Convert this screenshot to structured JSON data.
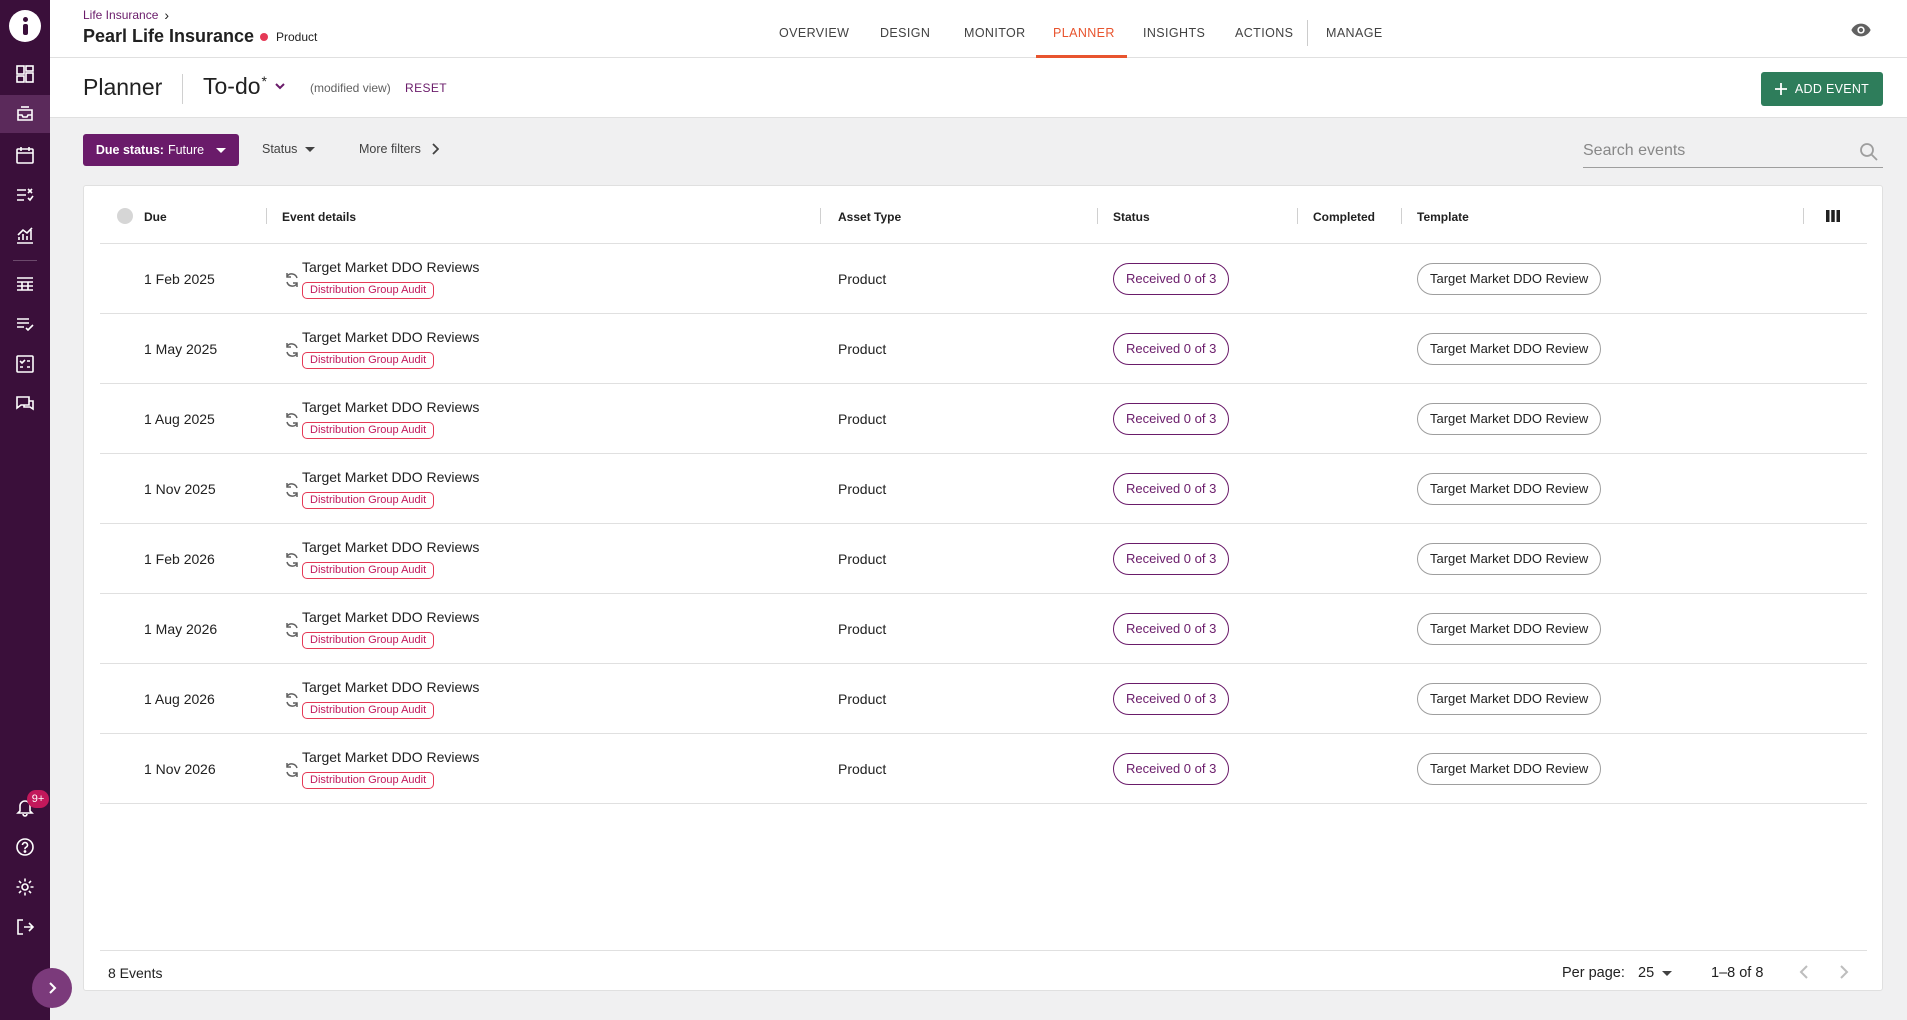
{
  "app": {
    "breadcrumb": "Life Insurance",
    "asset_name": "Pearl Life Insurance",
    "asset_type": "Product",
    "colors": {
      "brand": "#6a1b6a",
      "rail": "#3a0f3a",
      "active_tab": "#e8542e",
      "primary_button": "#2e7d5b",
      "tag": "#e53956"
    }
  },
  "nav": {
    "tabs": [
      "OVERVIEW",
      "DESIGN",
      "MONITOR",
      "PLANNER",
      "INSIGHTS",
      "ACTIONS",
      "MANAGE"
    ],
    "active": "PLANNER"
  },
  "rail": {
    "icons": [
      "dashboard-icon",
      "inbox-icon",
      "calendar-icon",
      "tasks-icon",
      "analytics-icon",
      "table-icon",
      "checklist-icon",
      "checkbox-icon",
      "chat-icon",
      "bell-icon",
      "help-icon",
      "settings-icon",
      "logout-icon"
    ],
    "notification_badge": "9+"
  },
  "planner": {
    "title": "Planner",
    "view_name": "To-do",
    "view_modified_marker": "*",
    "modified_note": "(modified view)",
    "reset_label": "RESET",
    "add_event_label": "ADD EVENT"
  },
  "filters": {
    "due_label": "Due status:",
    "due_value": "Future",
    "status_label": "Status",
    "more_label": "More filters",
    "search_placeholder": "Search events"
  },
  "table": {
    "headers": {
      "due": "Due",
      "event": "Event details",
      "asset_type": "Asset Type",
      "status": "Status",
      "completed": "Completed",
      "template": "Template"
    },
    "rows": [
      {
        "due": "1 Feb 2025",
        "title": "Target Market DDO Reviews",
        "tag": "Distribution Group Audit",
        "asset_type": "Product",
        "status": "Received 0 of 3",
        "completed": "",
        "template": "Target Market DDO Review"
      },
      {
        "due": "1 May 2025",
        "title": "Target Market DDO Reviews",
        "tag": "Distribution Group Audit",
        "asset_type": "Product",
        "status": "Received 0 of 3",
        "completed": "",
        "template": "Target Market DDO Review"
      },
      {
        "due": "1 Aug 2025",
        "title": "Target Market DDO Reviews",
        "tag": "Distribution Group Audit",
        "asset_type": "Product",
        "status": "Received 0 of 3",
        "completed": "",
        "template": "Target Market DDO Review"
      },
      {
        "due": "1 Nov 2025",
        "title": "Target Market DDO Reviews",
        "tag": "Distribution Group Audit",
        "asset_type": "Product",
        "status": "Received 0 of 3",
        "completed": "",
        "template": "Target Market DDO Review"
      },
      {
        "due": "1 Feb 2026",
        "title": "Target Market DDO Reviews",
        "tag": "Distribution Group Audit",
        "asset_type": "Product",
        "status": "Received 0 of 3",
        "completed": "",
        "template": "Target Market DDO Review"
      },
      {
        "due": "1 May 2026",
        "title": "Target Market DDO Reviews",
        "tag": "Distribution Group Audit",
        "asset_type": "Product",
        "status": "Received 0 of 3",
        "completed": "",
        "template": "Target Market DDO Review"
      },
      {
        "due": "1 Aug 2026",
        "title": "Target Market DDO Reviews",
        "tag": "Distribution Group Audit",
        "asset_type": "Product",
        "status": "Received 0 of 3",
        "completed": "",
        "template": "Target Market DDO Review"
      },
      {
        "due": "1 Nov 2026",
        "title": "Target Market DDO Reviews",
        "tag": "Distribution Group Audit",
        "asset_type": "Product",
        "status": "Received 0 of 3",
        "completed": "",
        "template": "Target Market DDO Review"
      }
    ]
  },
  "footer": {
    "count": "8 Events",
    "per_page_label": "Per page:",
    "per_page_value": "25",
    "range": "1–8 of 8"
  }
}
